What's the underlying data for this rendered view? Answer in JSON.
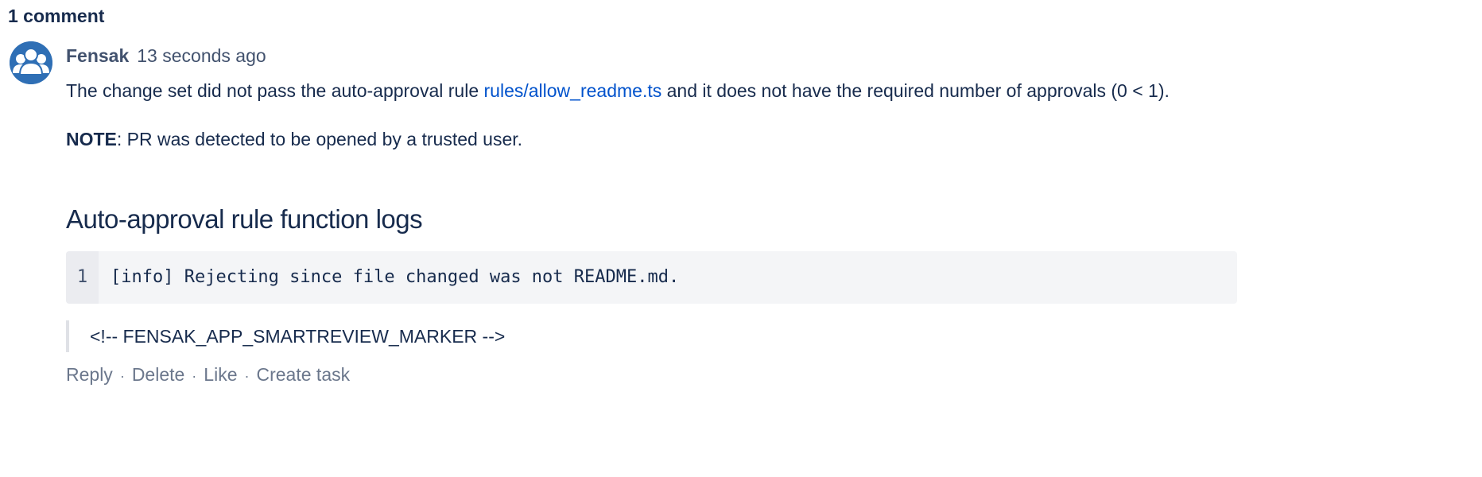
{
  "comments_header": {
    "count_label": "1 comment"
  },
  "comment": {
    "avatar_icon": "group-avatar-icon",
    "author": "Fensak",
    "timestamp": "13 seconds ago",
    "paragraph1": {
      "before_link": "The change set did not pass the auto-approval rule ",
      "link_text": "rules/allow_readme.ts",
      "after_link": " and it does not have the required number of approvals (0 < 1)."
    },
    "paragraph2": {
      "bold": "NOTE",
      "rest": ": PR was detected to be opened by a trusted user."
    },
    "heading": "Auto-approval rule function logs",
    "code": {
      "line_number": "1",
      "line_text": "[info] Rejecting since file changed was not README.md."
    },
    "quote": "<!-- FENSAK_APP_SMARTREVIEW_MARKER -->",
    "actions": {
      "reply": "Reply",
      "delete": "Delete",
      "like": "Like",
      "create_task": "Create task",
      "separator": "·"
    }
  },
  "colors": {
    "text": "#172b4d",
    "link": "#0052cc",
    "muted": "#6b778c",
    "avatar": "#2f6fb5",
    "code_bg": "#f4f5f7",
    "gutter_bg": "#ebecf0"
  }
}
